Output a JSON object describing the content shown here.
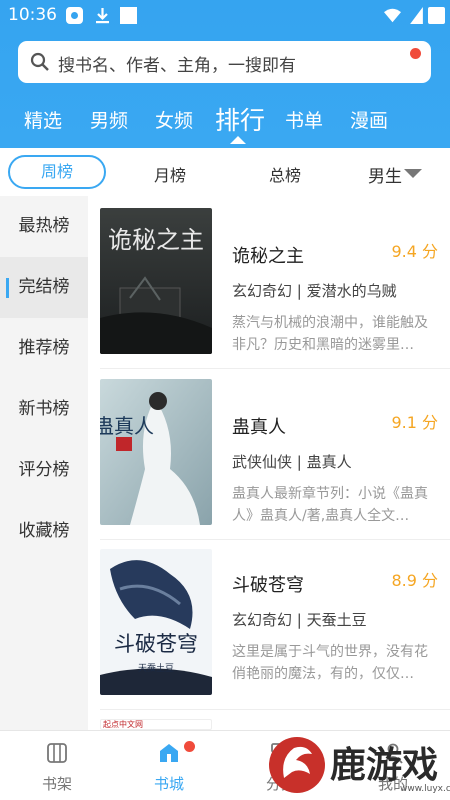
{
  "status_bar": {
    "time": "10:36"
  },
  "search": {
    "placeholder": "搜书名、作者、主角，一搜即有"
  },
  "nav": {
    "tabs": [
      {
        "label": "精选"
      },
      {
        "label": "男频"
      },
      {
        "label": "女频"
      },
      {
        "label": "排行",
        "active": true
      },
      {
        "label": "书单"
      },
      {
        "label": "漫画"
      }
    ]
  },
  "subtabs": {
    "items": [
      {
        "label": "周榜",
        "active": true
      },
      {
        "label": "月榜"
      },
      {
        "label": "总榜"
      }
    ],
    "gender": "男生"
  },
  "sidebar": {
    "items": [
      {
        "label": "最热榜"
      },
      {
        "label": "完结榜",
        "active": true
      },
      {
        "label": "推荐榜"
      },
      {
        "label": "新书榜"
      },
      {
        "label": "评分榜"
      },
      {
        "label": "收藏榜"
      }
    ]
  },
  "books": [
    {
      "title": "诡秘之主",
      "score": "9.4 分",
      "meta": "玄幻奇幻 | 爱潜水的乌贼",
      "desc": "蒸汽与机械的浪潮中，谁能触及非凡？历史和黑暗的迷雾里…",
      "cover_text": "诡秘之主"
    },
    {
      "title": "蛊真人",
      "score": "9.1 分",
      "meta": "武侠仙侠 | 蛊真人",
      "desc": "蛊真人最新章节列：小说《蛊真人》蛊真人/著,蛊真人全文…",
      "cover_text": "蛊真人"
    },
    {
      "title": "斗破苍穹",
      "score": "8.9 分",
      "meta": "玄幻奇幻 | 天蚕土豆",
      "desc": "这里是属于斗气的世界，没有花俏艳丽的魔法，有的，仅仅…",
      "cover_text": "斗破苍穹",
      "cover_sub": "天蚕土豆"
    },
    {
      "cover_text": "起点中文网"
    }
  ],
  "bottom_nav": {
    "items": [
      {
        "label": "书架"
      },
      {
        "label": "书城",
        "active": true
      },
      {
        "label": "分类"
      },
      {
        "label": "我的"
      }
    ]
  },
  "watermark": {
    "text": "鹿游戏",
    "url": "www.luyx.cc"
  },
  "colors": {
    "brand": "#35a4f0",
    "score": "#f5a623",
    "badge": "#f04b3b"
  }
}
